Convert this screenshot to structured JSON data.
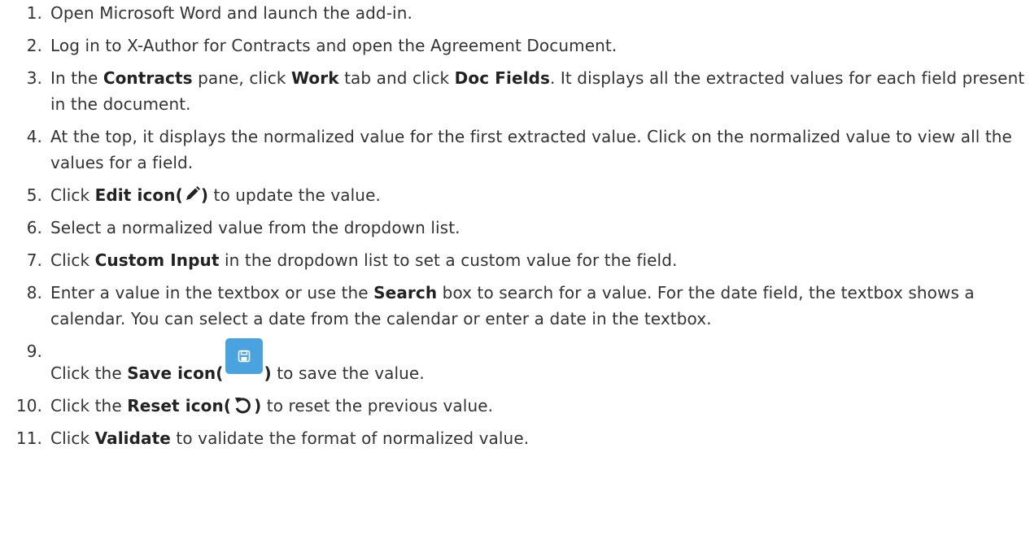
{
  "steps": [
    {
      "num": "1.",
      "parts": [
        "Open Microsoft Word and launch the add-in."
      ]
    },
    {
      "num": "2.",
      "parts": [
        "Log in to X-Author for Contracts and open the Agreement Document."
      ]
    },
    {
      "num": "3.",
      "parts": [
        "In the ",
        "Contracts",
        " pane, click ",
        "Work",
        " tab and click ",
        "Doc Fields",
        ". It displays all the extracted values for each field present in the document."
      ]
    },
    {
      "num": "4.",
      "parts": [
        "At the top, it displays the normalized value for the first extracted value. Click on the normalized value to view all the values for a field."
      ]
    },
    {
      "num": "5.",
      "parts": [
        "Click ",
        "Edit icon(",
        ")",
        " to update the value."
      ]
    },
    {
      "num": "6.",
      "parts": [
        "Select a normalized value from the dropdown list."
      ]
    },
    {
      "num": "7.",
      "parts": [
        "Click ",
        "Custom Input",
        " in the dropdown list to set a custom value for the field."
      ]
    },
    {
      "num": "8.",
      "parts": [
        "Enter a value in the textbox or use the ",
        "Search",
        " box to search for a value. For the date field, the textbox shows a calendar. You can select a date from the calendar or enter a date in the textbox."
      ]
    },
    {
      "num": "9.",
      "parts": [
        "Click the ",
        "Save icon(",
        ")",
        " to save the value."
      ]
    },
    {
      "num": "10.",
      "parts": [
        "Click the ",
        "Reset icon(",
        ")",
        " to reset the previous value."
      ]
    },
    {
      "num": "11.",
      "parts": [
        "Click ",
        "Validate",
        " to validate the format of normalized value."
      ]
    }
  ],
  "icons": {
    "edit": "pencil-icon",
    "save": "save-icon",
    "reset": "reset-icon",
    "save_bg": "#4aa3df"
  }
}
